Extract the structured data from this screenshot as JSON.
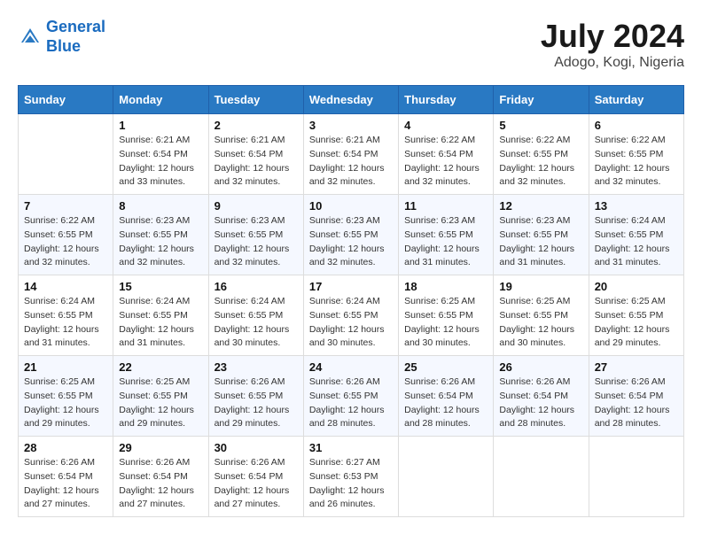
{
  "header": {
    "logo_line1": "General",
    "logo_line2": "Blue",
    "month_year": "July 2024",
    "location": "Adogo, Kogi, Nigeria"
  },
  "weekdays": [
    "Sunday",
    "Monday",
    "Tuesday",
    "Wednesday",
    "Thursday",
    "Friday",
    "Saturday"
  ],
  "weeks": [
    [
      {
        "day": "",
        "sunrise": "",
        "sunset": "",
        "daylight": ""
      },
      {
        "day": "1",
        "sunrise": "Sunrise: 6:21 AM",
        "sunset": "Sunset: 6:54 PM",
        "daylight": "Daylight: 12 hours and 33 minutes."
      },
      {
        "day": "2",
        "sunrise": "Sunrise: 6:21 AM",
        "sunset": "Sunset: 6:54 PM",
        "daylight": "Daylight: 12 hours and 32 minutes."
      },
      {
        "day": "3",
        "sunrise": "Sunrise: 6:21 AM",
        "sunset": "Sunset: 6:54 PM",
        "daylight": "Daylight: 12 hours and 32 minutes."
      },
      {
        "day": "4",
        "sunrise": "Sunrise: 6:22 AM",
        "sunset": "Sunset: 6:54 PM",
        "daylight": "Daylight: 12 hours and 32 minutes."
      },
      {
        "day": "5",
        "sunrise": "Sunrise: 6:22 AM",
        "sunset": "Sunset: 6:55 PM",
        "daylight": "Daylight: 12 hours and 32 minutes."
      },
      {
        "day": "6",
        "sunrise": "Sunrise: 6:22 AM",
        "sunset": "Sunset: 6:55 PM",
        "daylight": "Daylight: 12 hours and 32 minutes."
      }
    ],
    [
      {
        "day": "7",
        "sunrise": "Sunrise: 6:22 AM",
        "sunset": "Sunset: 6:55 PM",
        "daylight": "Daylight: 12 hours and 32 minutes."
      },
      {
        "day": "8",
        "sunrise": "Sunrise: 6:23 AM",
        "sunset": "Sunset: 6:55 PM",
        "daylight": "Daylight: 12 hours and 32 minutes."
      },
      {
        "day": "9",
        "sunrise": "Sunrise: 6:23 AM",
        "sunset": "Sunset: 6:55 PM",
        "daylight": "Daylight: 12 hours and 32 minutes."
      },
      {
        "day": "10",
        "sunrise": "Sunrise: 6:23 AM",
        "sunset": "Sunset: 6:55 PM",
        "daylight": "Daylight: 12 hours and 32 minutes."
      },
      {
        "day": "11",
        "sunrise": "Sunrise: 6:23 AM",
        "sunset": "Sunset: 6:55 PM",
        "daylight": "Daylight: 12 hours and 31 minutes."
      },
      {
        "day": "12",
        "sunrise": "Sunrise: 6:23 AM",
        "sunset": "Sunset: 6:55 PM",
        "daylight": "Daylight: 12 hours and 31 minutes."
      },
      {
        "day": "13",
        "sunrise": "Sunrise: 6:24 AM",
        "sunset": "Sunset: 6:55 PM",
        "daylight": "Daylight: 12 hours and 31 minutes."
      }
    ],
    [
      {
        "day": "14",
        "sunrise": "Sunrise: 6:24 AM",
        "sunset": "Sunset: 6:55 PM",
        "daylight": "Daylight: 12 hours and 31 minutes."
      },
      {
        "day": "15",
        "sunrise": "Sunrise: 6:24 AM",
        "sunset": "Sunset: 6:55 PM",
        "daylight": "Daylight: 12 hours and 31 minutes."
      },
      {
        "day": "16",
        "sunrise": "Sunrise: 6:24 AM",
        "sunset": "Sunset: 6:55 PM",
        "daylight": "Daylight: 12 hours and 30 minutes."
      },
      {
        "day": "17",
        "sunrise": "Sunrise: 6:24 AM",
        "sunset": "Sunset: 6:55 PM",
        "daylight": "Daylight: 12 hours and 30 minutes."
      },
      {
        "day": "18",
        "sunrise": "Sunrise: 6:25 AM",
        "sunset": "Sunset: 6:55 PM",
        "daylight": "Daylight: 12 hours and 30 minutes."
      },
      {
        "day": "19",
        "sunrise": "Sunrise: 6:25 AM",
        "sunset": "Sunset: 6:55 PM",
        "daylight": "Daylight: 12 hours and 30 minutes."
      },
      {
        "day": "20",
        "sunrise": "Sunrise: 6:25 AM",
        "sunset": "Sunset: 6:55 PM",
        "daylight": "Daylight: 12 hours and 29 minutes."
      }
    ],
    [
      {
        "day": "21",
        "sunrise": "Sunrise: 6:25 AM",
        "sunset": "Sunset: 6:55 PM",
        "daylight": "Daylight: 12 hours and 29 minutes."
      },
      {
        "day": "22",
        "sunrise": "Sunrise: 6:25 AM",
        "sunset": "Sunset: 6:55 PM",
        "daylight": "Daylight: 12 hours and 29 minutes."
      },
      {
        "day": "23",
        "sunrise": "Sunrise: 6:26 AM",
        "sunset": "Sunset: 6:55 PM",
        "daylight": "Daylight: 12 hours and 29 minutes."
      },
      {
        "day": "24",
        "sunrise": "Sunrise: 6:26 AM",
        "sunset": "Sunset: 6:55 PM",
        "daylight": "Daylight: 12 hours and 28 minutes."
      },
      {
        "day": "25",
        "sunrise": "Sunrise: 6:26 AM",
        "sunset": "Sunset: 6:54 PM",
        "daylight": "Daylight: 12 hours and 28 minutes."
      },
      {
        "day": "26",
        "sunrise": "Sunrise: 6:26 AM",
        "sunset": "Sunset: 6:54 PM",
        "daylight": "Daylight: 12 hours and 28 minutes."
      },
      {
        "day": "27",
        "sunrise": "Sunrise: 6:26 AM",
        "sunset": "Sunset: 6:54 PM",
        "daylight": "Daylight: 12 hours and 28 minutes."
      }
    ],
    [
      {
        "day": "28",
        "sunrise": "Sunrise: 6:26 AM",
        "sunset": "Sunset: 6:54 PM",
        "daylight": "Daylight: 12 hours and 27 minutes."
      },
      {
        "day": "29",
        "sunrise": "Sunrise: 6:26 AM",
        "sunset": "Sunset: 6:54 PM",
        "daylight": "Daylight: 12 hours and 27 minutes."
      },
      {
        "day": "30",
        "sunrise": "Sunrise: 6:26 AM",
        "sunset": "Sunset: 6:54 PM",
        "daylight": "Daylight: 12 hours and 27 minutes."
      },
      {
        "day": "31",
        "sunrise": "Sunrise: 6:27 AM",
        "sunset": "Sunset: 6:53 PM",
        "daylight": "Daylight: 12 hours and 26 minutes."
      },
      {
        "day": "",
        "sunrise": "",
        "sunset": "",
        "daylight": ""
      },
      {
        "day": "",
        "sunrise": "",
        "sunset": "",
        "daylight": ""
      },
      {
        "day": "",
        "sunrise": "",
        "sunset": "",
        "daylight": ""
      }
    ]
  ]
}
